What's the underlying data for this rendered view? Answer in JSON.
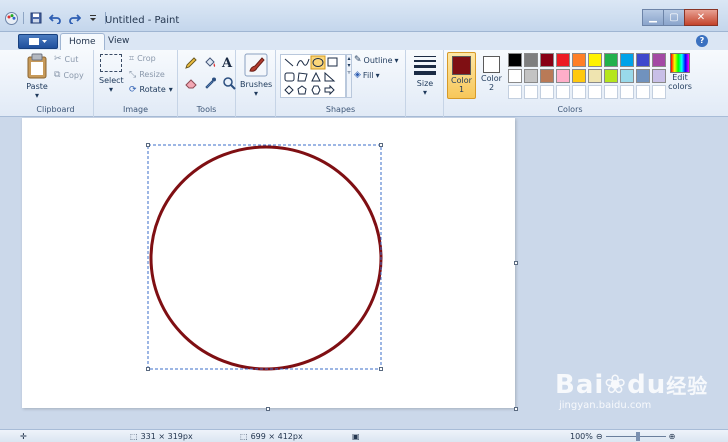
{
  "window": {
    "title": "Untitled - Paint"
  },
  "tabs": {
    "home": "Home",
    "view": "View"
  },
  "clipboard": {
    "paste": "Paste",
    "cut": "Cut",
    "copy": "Copy",
    "group": "Clipboard"
  },
  "image": {
    "select": "Select",
    "crop": "Crop",
    "resize": "Resize",
    "rotate": "Rotate",
    "group": "Image"
  },
  "tools": {
    "group": "Tools"
  },
  "brushes": {
    "label": "Brushes"
  },
  "shapes": {
    "outline": "Outline",
    "fill": "Fill",
    "group": "Shapes"
  },
  "size": {
    "label": "Size"
  },
  "colors": {
    "color1_label_a": "Color",
    "color1_label_b": "1",
    "color2_label_a": "Color",
    "color2_label_b": "2",
    "edit_a": "Edit",
    "edit_b": "colors",
    "group": "Colors",
    "color1": "#7f0f13",
    "color2": "#ffffff",
    "palette_row1": [
      "#000000",
      "#7f7f7f",
      "#880015",
      "#ed1c24",
      "#ff7f27",
      "#fff200",
      "#22b14c",
      "#00a2e8",
      "#3f48cc",
      "#a349a4"
    ],
    "palette_row2": [
      "#ffffff",
      "#c3c3c3",
      "#b97a57",
      "#ffaec9",
      "#ffc90e",
      "#efe4b0",
      "#b5e61d",
      "#99d9ea",
      "#7092be",
      "#c8bfe7"
    ]
  },
  "status": {
    "selection_size": "331 × 319px",
    "canvas_size": "699 × 412px",
    "zoom": "100%"
  },
  "watermark": {
    "brand": "Bai",
    "brand2": "du",
    "cn": "经验",
    "url": "jingyan.baidu.com"
  },
  "drawing": {
    "circle_color": "#7f0f13"
  }
}
